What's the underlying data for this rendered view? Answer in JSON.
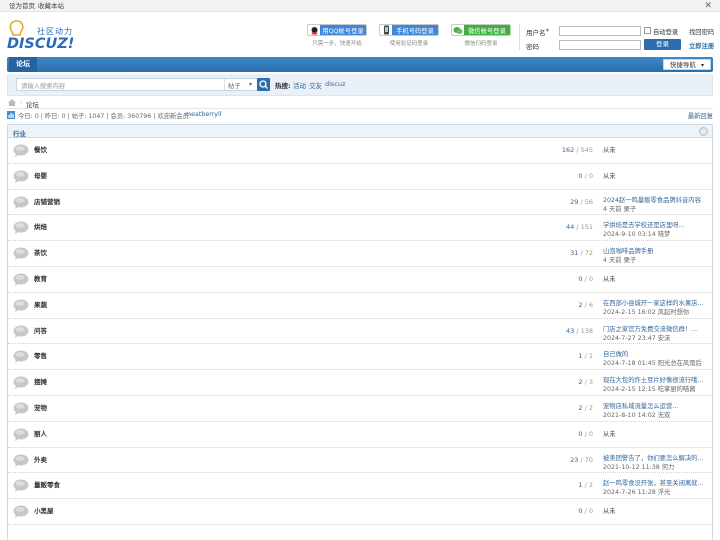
{
  "topbar": {
    "set_home": "设为首页",
    "bookmark": "收藏本站"
  },
  "logo": {
    "slogan": "社区动力",
    "brand": "DISCUZ!"
  },
  "social_login": [
    {
      "label": "用QQ帐号登录",
      "hint": "只需一步，快速开始",
      "color": "#3f86d6",
      "icon": "qq-icon"
    },
    {
      "label": "手机号码登录",
      "hint": "使用验证码登录",
      "color": "#3f86d6",
      "icon": "phone-icon"
    },
    {
      "label": "微信帐号登录",
      "hint": "微信扫码登录",
      "color": "#3fb03f",
      "icon": "wechat-icon"
    }
  ],
  "login": {
    "username_label": "用户名",
    "password_label": "密码",
    "auto_login": "自动登录",
    "find_password": "找回密码",
    "login_button": "登录",
    "register": "立即注册"
  },
  "nav": {
    "forum_tab": "论坛",
    "quick_nav": "快捷导航"
  },
  "search": {
    "placeholder": "请输入搜索内容",
    "type": "帖子",
    "hot_label": "热搜:",
    "hot": [
      "活动",
      "交友",
      "discuz"
    ]
  },
  "breadcrumb": {
    "current": "论坛"
  },
  "stats": {
    "text": "今日: 0 | 昨日: 0 | 帖子: 1047 | 会员: 360796 | 欢迎新会员: ",
    "new_member": "meatberryll",
    "latest": "最新回复"
  },
  "category": {
    "title": "行业"
  },
  "forums": [
    {
      "name": "餐饮",
      "threads": "162",
      "posts": "545",
      "last1": "从未",
      "last2": ""
    },
    {
      "name": "母婴",
      "threads": "0",
      "posts": "0",
      "last1": "从未",
      "last2": ""
    },
    {
      "name": "店铺营销",
      "threads": "29",
      "posts": "56",
      "last1": "2024赵一鸣量贩零食品牌抖音内容...",
      "last2": "4 天前 栗子"
    },
    {
      "name": "烘焙",
      "threads": "44",
      "posts": "151",
      "last1": "学烘焙是去学校还是店里呀...",
      "last2": "2024-9-10 03:14 晓梦"
    },
    {
      "name": "茶饮",
      "threads": "31",
      "posts": "72",
      "last1": "山泡咖啡品牌手册",
      "last2": "4 天前 栗子"
    },
    {
      "name": "教育",
      "threads": "0",
      "posts": "0",
      "last1": "从未",
      "last2": ""
    },
    {
      "name": "果蔬",
      "threads": "2",
      "posts": "6",
      "last1": "在西部小县城开一家这样的水果店...",
      "last2": "2024-2-15 16:02 风起时想你"
    },
    {
      "name": "问答",
      "threads": "43",
      "posts": "138",
      "last1": "门店之家官方免费交流微信群！...",
      "last2": "2024-7-27 23:47 安沫"
    },
    {
      "name": "零售",
      "threads": "1",
      "posts": "1",
      "last1": "自己做的",
      "last2": "2024-7-18 01:45 阳光总在风雨后"
    },
    {
      "name": "摆摊",
      "threads": "2",
      "posts": "3",
      "last1": "现在大包的炸土豆片好像很流行哦...",
      "last2": "2024-2-15 12:15 吃掌厨的喵酱"
    },
    {
      "name": "宠物",
      "threads": "2",
      "posts": "2",
      "last1": "宠物店私域流量怎么运营...",
      "last2": "2021-8-10 14:02 无双"
    },
    {
      "name": "丽人",
      "threads": "0",
      "posts": "0",
      "last1": "从未",
      "last2": ""
    },
    {
      "name": "外卖",
      "threads": "23",
      "posts": "70",
      "last1": "被美团警告了，你们要怎么解决的...",
      "last2": "2021-10-12 11:38 何力"
    },
    {
      "name": "量贩零食",
      "threads": "1",
      "posts": "2",
      "last1": "赵一鸣零食没开张，甚至关闭离就...",
      "last2": "2024-7-26 11:28 浮光"
    },
    {
      "name": "小黑屋",
      "threads": "0",
      "posts": "0",
      "last1": "从未",
      "last2": ""
    }
  ],
  "colors": {
    "nav_blue": "#2b6eab",
    "link_blue": "#336699",
    "accent_wechat": "#3fb03f"
  }
}
